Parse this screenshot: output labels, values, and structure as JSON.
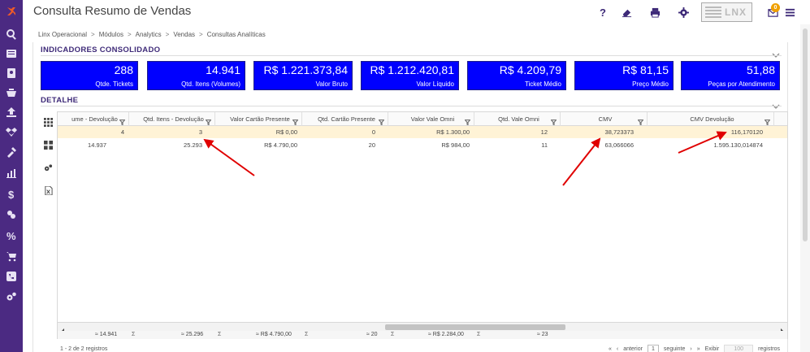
{
  "app": {
    "title": "Consulta Resumo de Vendas",
    "logo_text": "LNX",
    "mail_count": "0"
  },
  "header_icons": [
    "help-icon",
    "eraser-icon",
    "print-icon",
    "gear-icon",
    "mail-icon",
    "menu-icon"
  ],
  "sidebar": {
    "items": [
      "logo-icon",
      "search-icon",
      "list-icon",
      "address-book-icon",
      "cart-icon",
      "upload-icon",
      "dropbox-icon",
      "tools-icon",
      "chart-icon",
      "dollar-icon",
      "money-icon",
      "percent-icon",
      "shopping-cart-icon",
      "phone-icon",
      "gears-icon"
    ]
  },
  "breadcrumb": [
    "Linx Operacional",
    "Módulos",
    "Analytics",
    "Vendas",
    "Consultas Analíticas"
  ],
  "breadcrumb_separator": ">",
  "sections": {
    "indicadores": "INDICADORES CONSOLIDADO",
    "detalhe": "DETALHE"
  },
  "kpis": [
    {
      "value": "288",
      "label": "Qtde. Tickets"
    },
    {
      "value": "14.941",
      "label": "Qtd. Itens (Volumes)"
    },
    {
      "value": "R$ 1.221.373,84",
      "label": "Valor Bruto"
    },
    {
      "value": "R$ 1.212.420,81",
      "label": "Valor Líquido"
    },
    {
      "value": "R$ 4.209,79",
      "label": "Ticket Médio"
    },
    {
      "value": "R$ 81,15",
      "label": "Preço Médio"
    },
    {
      "value": "51,88",
      "label": "Peças por Atendimento"
    }
  ],
  "kpi_color": "#0000ff",
  "grid": {
    "columns": [
      "ume - Devolução",
      "Qtd. Itens - Devolução",
      "Valor Cartão Presente",
      "Qtd. Cartão Presente",
      "Valor Vale Omni",
      "Qtd. Vale Omni",
      "CMV",
      "CMV Devolução"
    ],
    "rows": [
      [
        "4",
        "3",
        "R$ 0,00",
        "0",
        "R$ 1.300,00",
        "12",
        "38,723373",
        "116,170120"
      ],
      [
        "14.937",
        "25.293",
        "R$ 4.790,00",
        "20",
        "R$ 984,00",
        "11",
        "63,066066",
        "1.595.130,014874"
      ]
    ],
    "selected_row": 0,
    "totals": [
      "≈ 14.941",
      "≈ 25.296",
      "≈ R$ 4.790,00",
      "≈ 20",
      "≈ R$ 2.284,00",
      "≈ 23"
    ],
    "sigma": "Σ"
  },
  "pager": {
    "record_count": "1 - 2 de 2 registros",
    "prev_label": "anterior",
    "page": "1",
    "next_label": "seguinte",
    "show_label": "Exibir",
    "page_size": "100",
    "records_label": "registros"
  },
  "annotation_color": "#e00000"
}
